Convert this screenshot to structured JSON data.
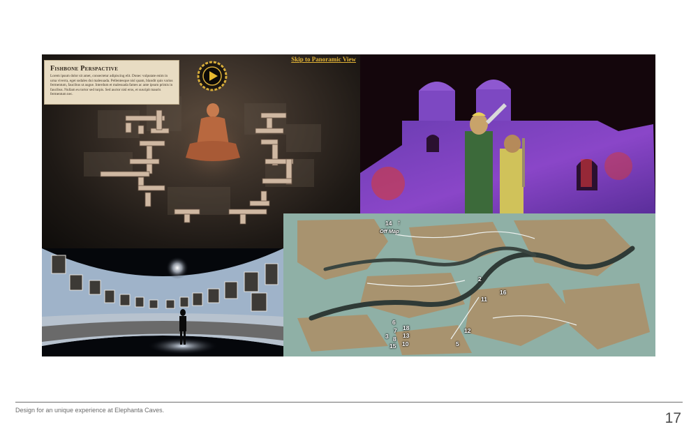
{
  "fishbone": {
    "card_title": "Fishbone Perspactive",
    "card_body": "Lorem ipsum dolor sit amet, consectetur adipiscing elit. Donec vulputate enim in urna viverra, eget sodales dui malesuada. Pellentesque nisl quam, blandit quis varius fermentum, faucibus ut augue. Interdum et malesuada fames ac ante ipsum primis in faucibus. Nullam eu tortor sed turpis. Sed auctor nisl eros, et suscipit mauris fermentum nec.",
    "skip_link": "Skip to Panoramic View",
    "play_icon": "play-icon",
    "accent": "#e2b437"
  },
  "map": {
    "off_map_label": "Off Map",
    "labels": [
      "14",
      "2",
      "11",
      "16",
      "6",
      "7",
      "18",
      "3",
      "8",
      "13",
      "15",
      "10",
      "12",
      "5"
    ]
  },
  "footer": {
    "caption": "Design for an unique experience at Elephanta Caves.",
    "page_number": "17"
  }
}
